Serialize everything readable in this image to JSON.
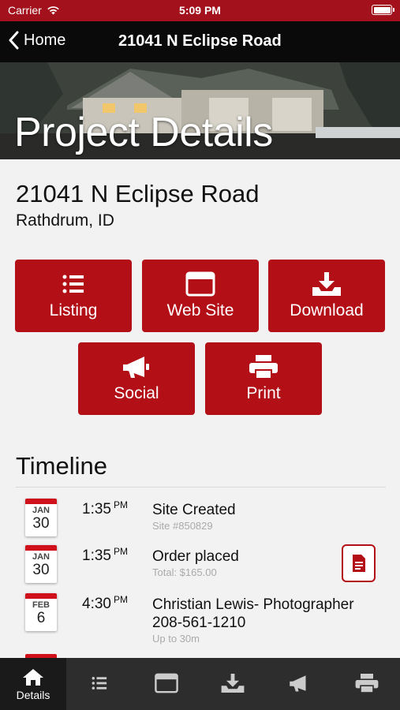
{
  "status_bar": {
    "carrier": "Carrier",
    "time": "5:09 PM"
  },
  "nav": {
    "back_label": "Home",
    "title": "21041 N Eclipse Road"
  },
  "hero": {
    "title": "Project Details"
  },
  "address": {
    "street": "21041 N Eclipse Road",
    "city": "Rathdrum, ID"
  },
  "actions": {
    "listing": "Listing",
    "website": "Web Site",
    "download": "Download",
    "social": "Social",
    "print": "Print"
  },
  "timeline": {
    "title": "Timeline",
    "entries": [
      {
        "month": "JAN",
        "day": "30",
        "time": "1:35",
        "ampm": "PM",
        "title": "Site Created",
        "sub": "Site #850829"
      },
      {
        "month": "JAN",
        "day": "30",
        "time": "1:35",
        "ampm": "PM",
        "title": "Order placed",
        "sub": "Total: $165.00"
      },
      {
        "month": "FEB",
        "day": "6",
        "time": "4:30",
        "ampm": "PM",
        "title": "Christian Lewis- Photographer",
        "title2": "208-561-1210",
        "sub": "Up to 30m"
      }
    ]
  },
  "tab_bar": {
    "details_label": "Details"
  },
  "colors": {
    "brand_red": "#b30f17",
    "status_red": "#a3121c",
    "tab_bg": "#2d2d2d"
  }
}
